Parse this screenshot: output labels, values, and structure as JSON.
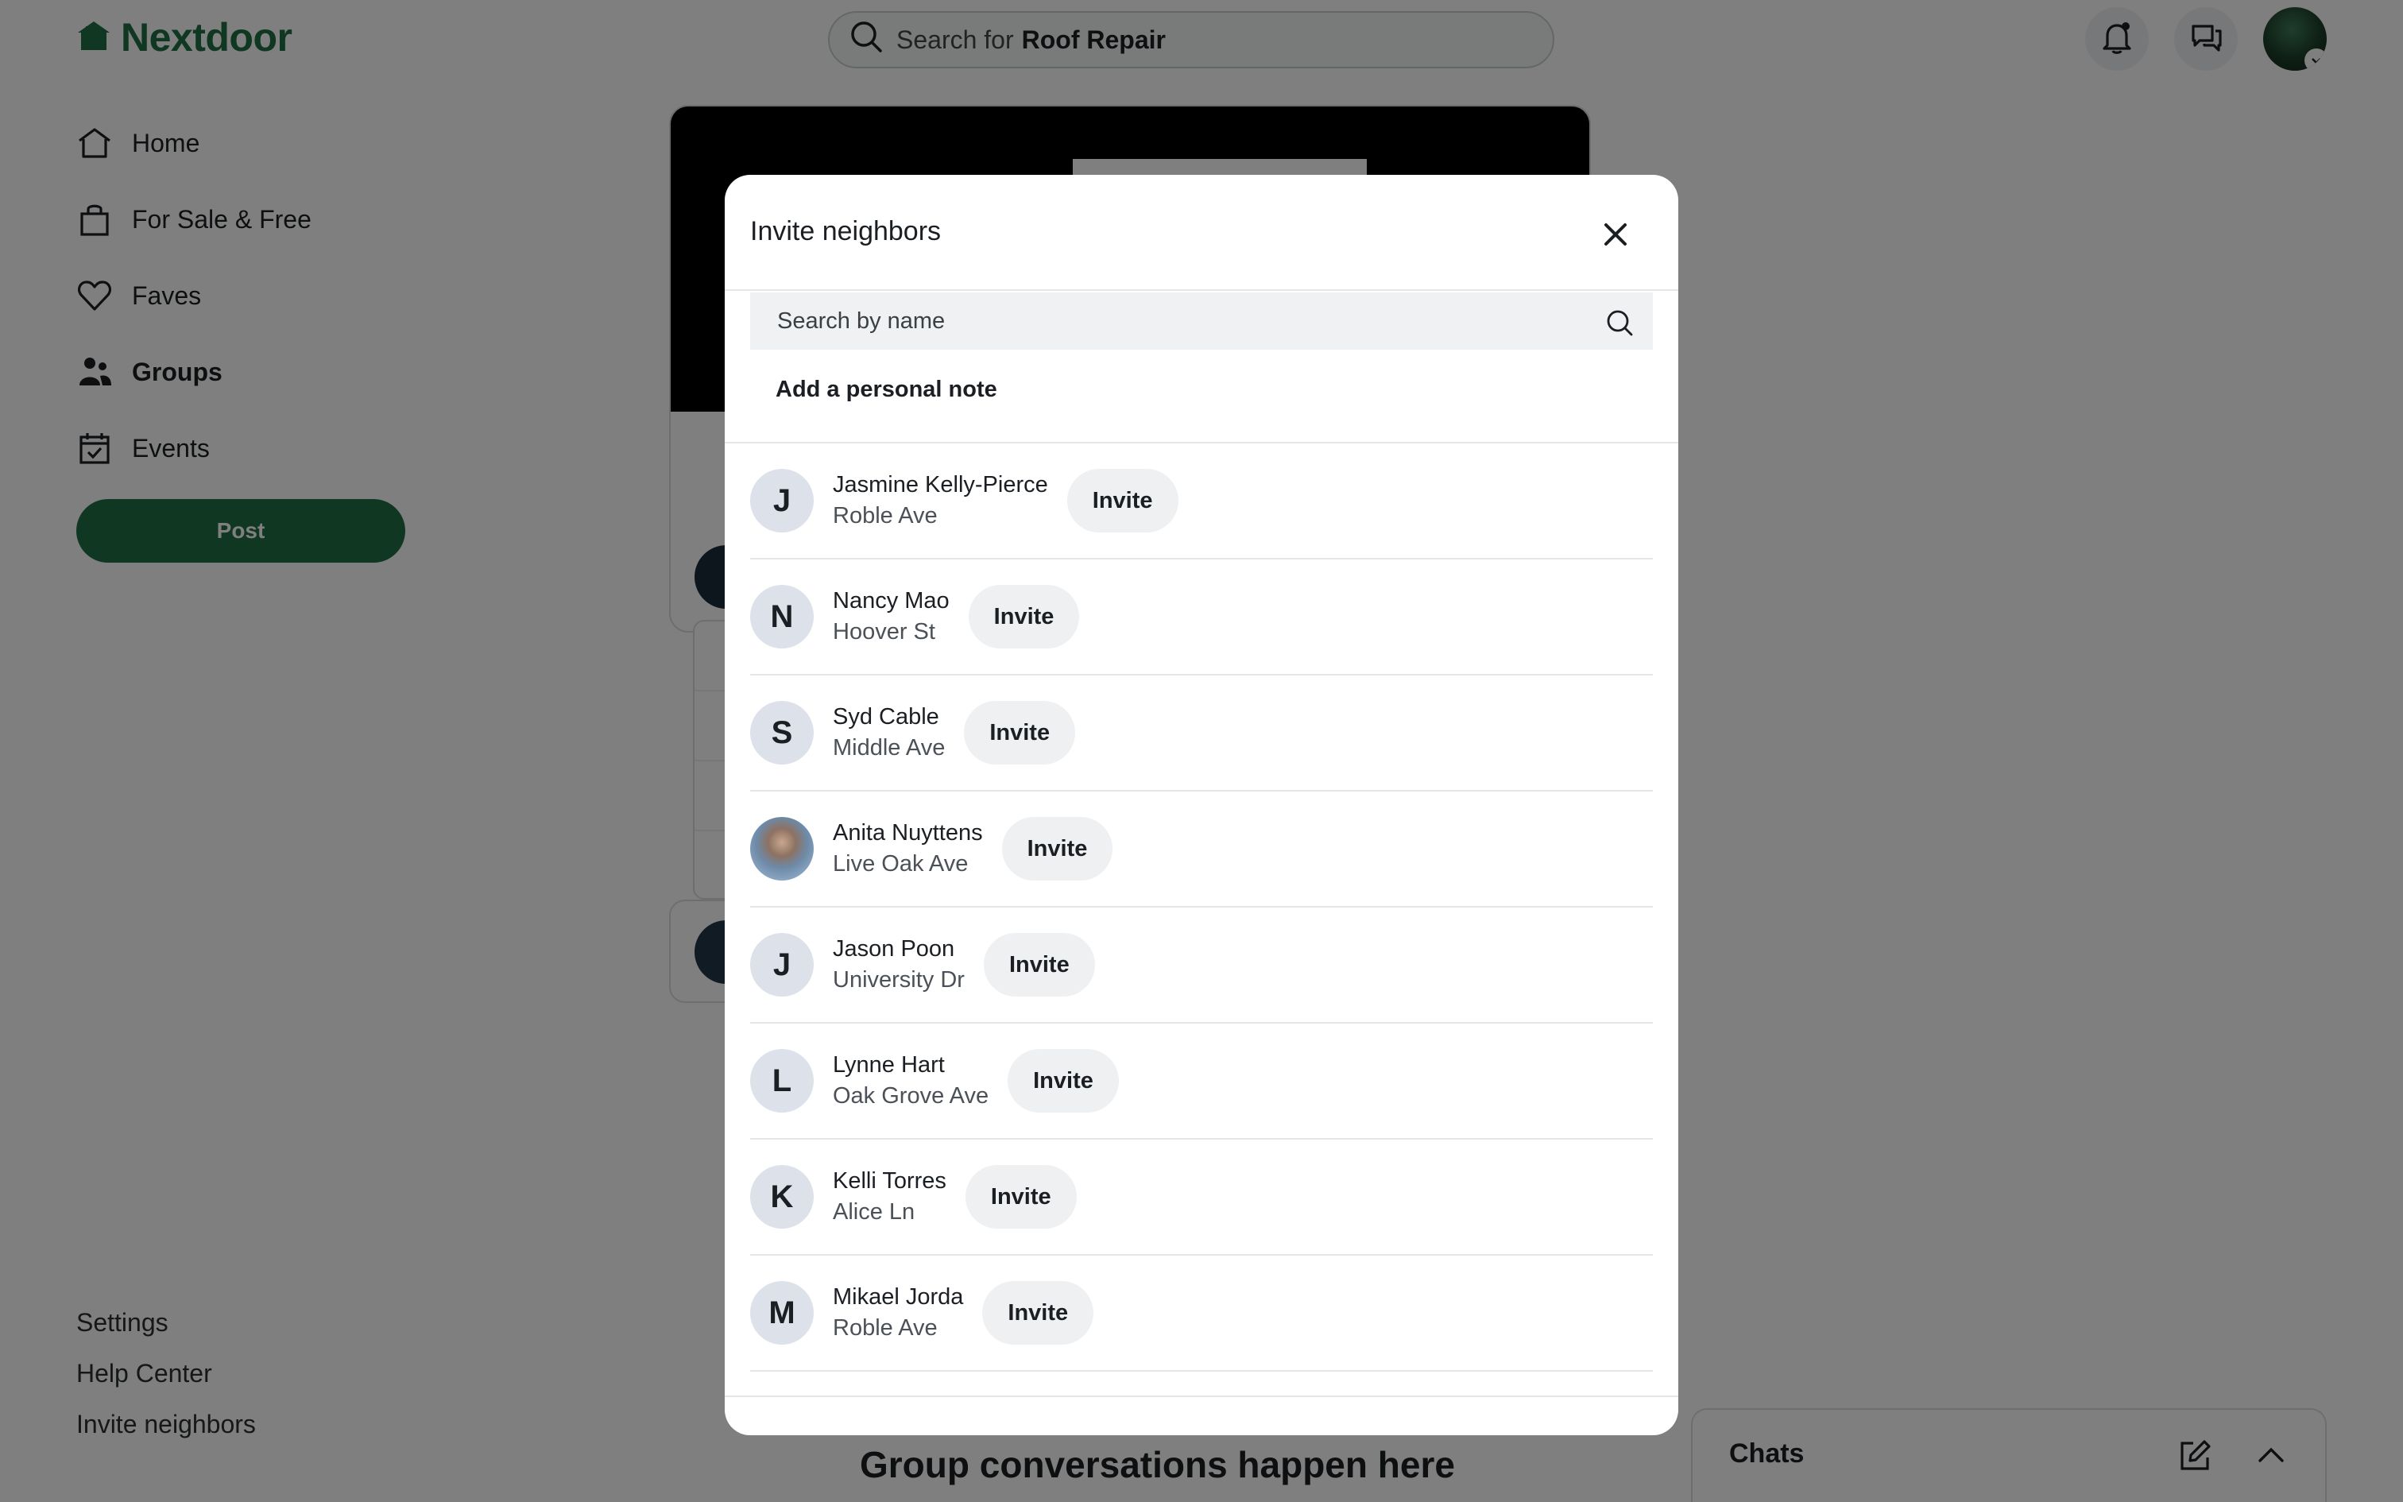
{
  "app": {
    "name": "Nextdoor",
    "brand_color": "#1f6e43"
  },
  "search": {
    "prefix": "Search for",
    "term": "Roof Repair"
  },
  "sidebar": {
    "items": [
      {
        "label": "Home",
        "icon": "home-icon"
      },
      {
        "label": "For Sale & Free",
        "icon": "shopping-bag-icon"
      },
      {
        "label": "Faves",
        "icon": "heart-icon"
      },
      {
        "label": "Groups",
        "icon": "groups-icon",
        "active": true
      },
      {
        "label": "Events",
        "icon": "calendar-icon"
      }
    ],
    "post_label": "Post",
    "footer_links": [
      "Settings",
      "Help Center",
      "Invite neighbors"
    ]
  },
  "background": {
    "conversation_heading": "Group conversations happen here"
  },
  "chats": {
    "label": "Chats"
  },
  "modal": {
    "title": "Invite neighbors",
    "search_placeholder": "Search by name",
    "personal_note_label": "Add a personal note",
    "invite_label": "Invite",
    "neighbors": [
      {
        "initial": "J",
        "name": "Jasmine Kelly-Pierce",
        "street": "Roble Ave"
      },
      {
        "initial": "N",
        "name": "Nancy Mao",
        "street": "Hoover St"
      },
      {
        "initial": "S",
        "name": "Syd Cable",
        "street": "Middle Ave"
      },
      {
        "initial": "",
        "name": "Anita Nuyttens",
        "street": "Live Oak Ave",
        "photo": true
      },
      {
        "initial": "J",
        "name": "Jason Poon",
        "street": "University Dr"
      },
      {
        "initial": "L",
        "name": "Lynne Hart",
        "street": "Oak Grove Ave"
      },
      {
        "initial": "K",
        "name": "Kelli Torres",
        "street": "Alice Ln"
      },
      {
        "initial": "M",
        "name": "Mikael Jorda",
        "street": "Roble Ave"
      }
    ]
  }
}
